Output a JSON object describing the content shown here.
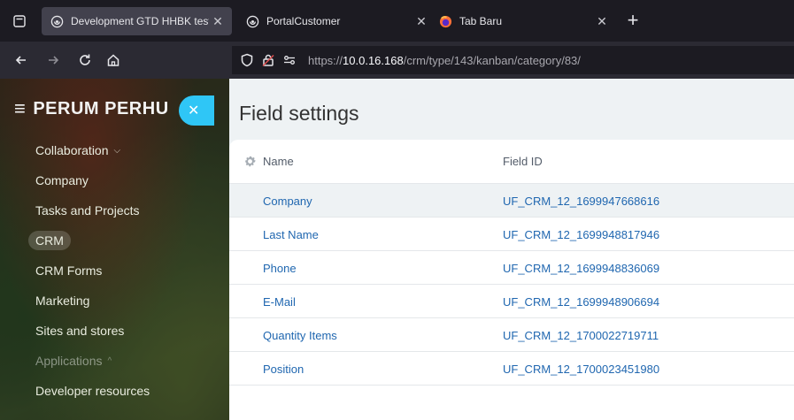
{
  "browser": {
    "tabs": [
      {
        "title": "Development GTD HHBK test",
        "favicon": "globe-icon",
        "active": true
      },
      {
        "title": "PortalCustomer",
        "favicon": "globe-icon",
        "active": false
      },
      {
        "title": "Tab Baru",
        "favicon": "firefox-icon",
        "active": false
      }
    ],
    "url": {
      "scheme": "https://",
      "host": "10.0.16.168",
      "path": "/crm/type/143/kanban/category/83/"
    }
  },
  "sidebar": {
    "brand": "PERUM PERHU",
    "items": [
      {
        "label": "Collaboration",
        "caret": "⌵"
      },
      {
        "label": "Company"
      },
      {
        "label": "Tasks and Projects"
      },
      {
        "label": "CRM"
      },
      {
        "label": "CRM Forms"
      },
      {
        "label": "Marketing"
      },
      {
        "label": "Sites and stores"
      },
      {
        "label": "Applications",
        "caret": "^"
      },
      {
        "label": "Developer resources"
      }
    ]
  },
  "main": {
    "title": "Field settings",
    "columns": {
      "name": "Name",
      "field_id": "Field ID"
    },
    "rows": [
      {
        "name": "Company",
        "field_id": "UF_CRM_12_1699947668616"
      },
      {
        "name": "Last Name",
        "field_id": "UF_CRM_12_1699948817946"
      },
      {
        "name": "Phone",
        "field_id": "UF_CRM_12_1699948836069"
      },
      {
        "name": "E-Mail",
        "field_id": "UF_CRM_12_1699948906694"
      },
      {
        "name": "Quantity Items",
        "field_id": "UF_CRM_12_1700022719711"
      },
      {
        "name": "Position",
        "field_id": "UF_CRM_12_1700023451980"
      }
    ]
  },
  "colors": {
    "accent": "#2fc6f6",
    "link": "#2067b0"
  }
}
